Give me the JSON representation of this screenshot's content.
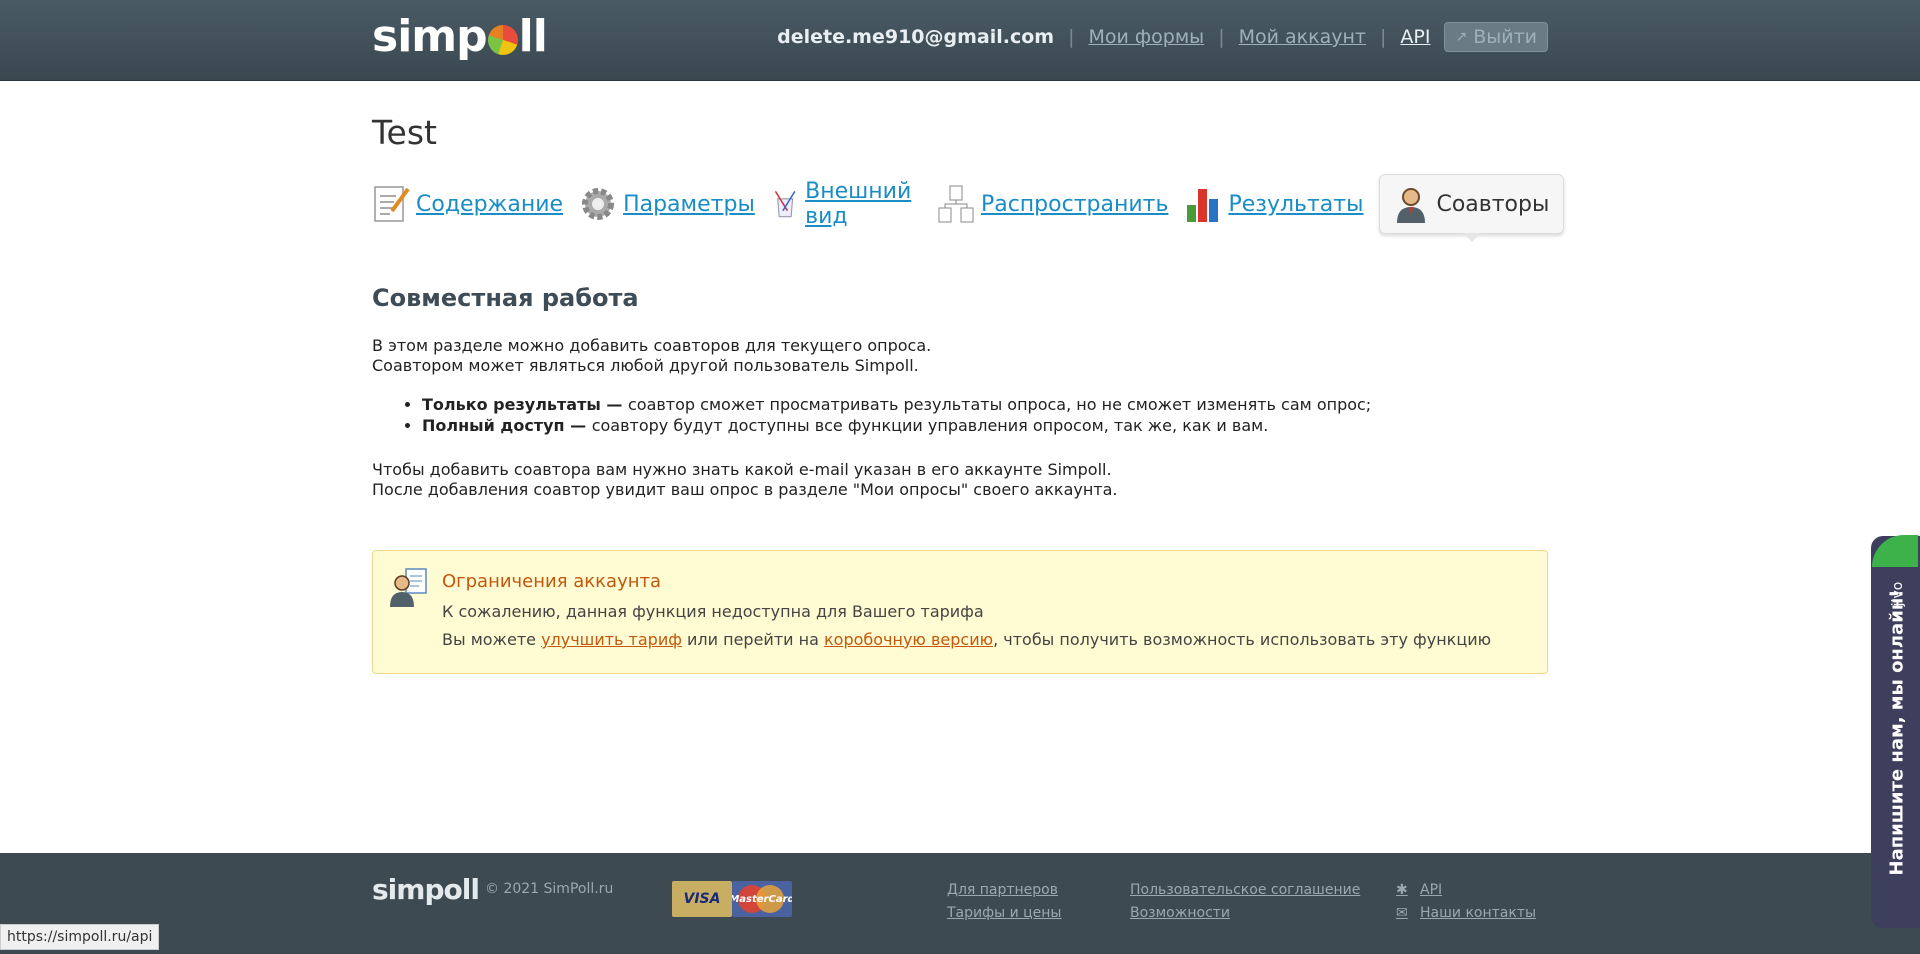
{
  "header": {
    "logo": "simpoll",
    "email": "delete.me910@gmail.com",
    "links": [
      "Мои формы",
      "Мой аккаунт",
      "API"
    ],
    "logout": "Выйти"
  },
  "page": {
    "title": "Test"
  },
  "tabs": [
    {
      "label": "Содержание",
      "icon": "edit-icon",
      "active": false
    },
    {
      "label": "Параметры",
      "icon": "gear-icon",
      "active": false
    },
    {
      "label": "Внешний вид",
      "icon": "paint-icon",
      "active": false
    },
    {
      "label": "Распространить",
      "icon": "share-icon",
      "active": false
    },
    {
      "label": "Результаты",
      "icon": "bar-chart-icon",
      "active": false
    },
    {
      "label": "Соавторы",
      "icon": "coauthor-icon",
      "active": true
    }
  ],
  "content": {
    "section_title": "Совместная работа",
    "intro_line1": "В этом разделе можно добавить соавторов для текущего опроса.",
    "intro_line2": "Соавтором может являться любой другой пользователь Simpoll.",
    "bullet1_bold": "Только результаты — ",
    "bullet1_text": "соавтор сможет просматривать результаты опроса, но не сможет изменять сам опрос;",
    "bullet2_bold": "Полный доступ — ",
    "bullet2_text": "соавтору будут доступны все функции управления опросом, так же, как и вам.",
    "outro_line1": "Чтобы добавить соавтора вам нужно знать какой e-mail указан в его аккаунте Simpoll.",
    "outro_line2": "После добавления соавтор увидит ваш опрос в разделе \"Мои опросы\" своего аккаунта."
  },
  "notice": {
    "title": "Ограничения аккаунта",
    "line1": "К сожалению, данная функция недоступна для Вашего тарифа",
    "line2_prefix": "Вы можете ",
    "link1": "улучшить тариф",
    "line2_mid": " или перейти на ",
    "link2": "коробочную версию",
    "line2_suffix": ", чтобы получить возможность использовать эту функцию"
  },
  "footer": {
    "logo": "simpoll",
    "copyright": "© 2021 SimPoll.ru",
    "card_visa": "VISA",
    "card_mc": "MasterCard",
    "col1": [
      "Для партнеров",
      "Тарифы и цены"
    ],
    "col2": [
      "Пользовательское соглашение",
      "Возможности"
    ],
    "col3": [
      "API",
      "Наши контакты"
    ]
  },
  "statusbar": "https://simpoll.ru/api",
  "jivo": {
    "logo": "jivo",
    "text": "Напишите нам, мы онлайн!"
  },
  "colors": {
    "header_bg": "#3f4d56",
    "link": "#1a8dc7",
    "notice_bg": "#fffbd2",
    "notice_title": "#c2590d",
    "footer_bg": "#3d4a52",
    "jivo_bg": "#3d3f5c",
    "jivo_leaf": "#3db14a"
  }
}
